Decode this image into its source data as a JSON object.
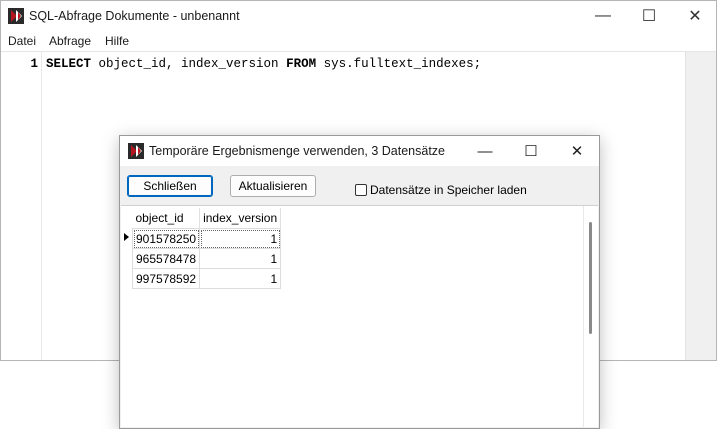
{
  "main_window": {
    "title": "SQL-Abfrage Dokumente - unbenannt",
    "controls": {
      "minimize": "—",
      "maximize": "☐",
      "close": "✕"
    },
    "menu": [
      {
        "label": "Datei"
      },
      {
        "label": "Abfrage"
      },
      {
        "label": "Hilfe"
      }
    ],
    "editor": {
      "line_number": "1",
      "code": {
        "kw1": "SELECT",
        "part1": " object_id, index_version ",
        "kw2": "FROM",
        "part2": " sys.fulltext_indexes;"
      }
    }
  },
  "dialog": {
    "title": "Temporäre Ergebnismenge verwenden, 3 Datensätze",
    "controls": {
      "minimize": "—",
      "maximize": "☐",
      "close": "✕"
    },
    "buttons": {
      "close_label": "Schließen",
      "refresh_label": "Aktualisieren"
    },
    "checkbox": {
      "label": "Datensätze in Speicher laden",
      "checked": false
    },
    "grid": {
      "columns": [
        "object_id",
        "index_version"
      ],
      "rows": [
        {
          "object_id": "901578250",
          "index_version": "1"
        },
        {
          "object_id": "965578478",
          "index_version": "1"
        },
        {
          "object_id": "997578592",
          "index_version": "1"
        }
      ]
    }
  },
  "colors": {
    "icon_red": "#b4141e",
    "icon_dark": "#2a2a2a",
    "default_button_border": "#0067c0"
  }
}
